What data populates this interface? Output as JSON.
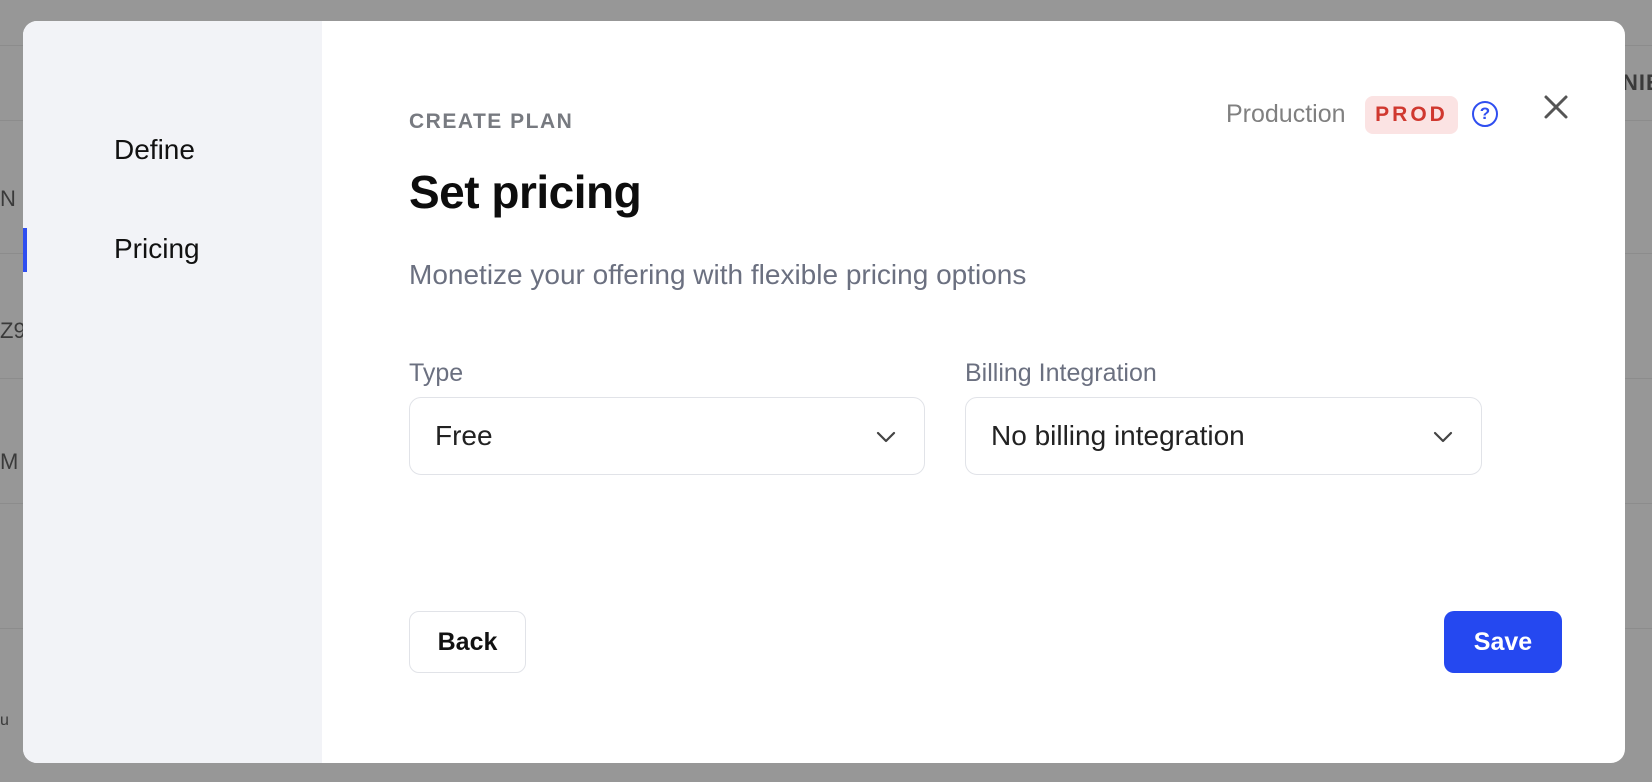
{
  "background": {
    "fragments": [
      "N",
      "Z9",
      "M",
      "u",
      "NIE"
    ]
  },
  "sidebar": {
    "items": [
      {
        "label": "Define",
        "active": false
      },
      {
        "label": "Pricing",
        "active": true
      }
    ]
  },
  "header": {
    "eyebrow": "CREATE PLAN",
    "title": "Set pricing",
    "subtitle": "Monetize your offering with flexible pricing options",
    "environment_label": "Production",
    "environment_badge": "PROD",
    "help_icon": "question-circle-icon",
    "close_icon": "close-icon"
  },
  "form": {
    "type": {
      "label": "Type",
      "value": "Free"
    },
    "billing": {
      "label": "Billing Integration",
      "value": "No billing integration"
    }
  },
  "actions": {
    "back_label": "Back",
    "save_label": "Save"
  },
  "colors": {
    "accent": "#2548f0",
    "badge_bg": "#fbe3e3",
    "badge_text": "#d0382f",
    "sidebar_bg": "#f2f3f7"
  }
}
